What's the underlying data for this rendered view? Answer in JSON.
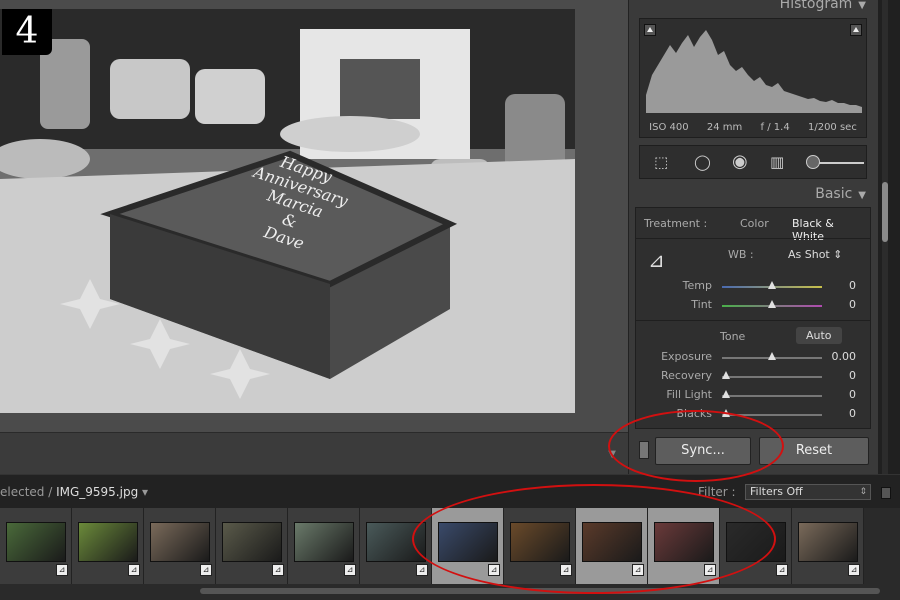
{
  "step_badge": "4",
  "photo": {
    "cake_text_lines": [
      "Happy",
      "Anniversary",
      "Marcia",
      "&",
      "Dave"
    ]
  },
  "right_panel": {
    "histogram": {
      "title": "Histogram",
      "exif": {
        "iso": "ISO 400",
        "focal_length": "24 mm",
        "aperture": "f / 1.4",
        "shutter": "1/200 sec"
      }
    },
    "tools": [
      "crop-overlay-icon",
      "spot-removal-icon",
      "red-eye-icon",
      "graduated-filter-icon",
      "adjustment-brush-icon"
    ],
    "basic": {
      "title": "Basic",
      "treatment_label": "Treatment :",
      "treatment_color": "Color",
      "treatment_bw": "Black & White",
      "wb_label": "WB :",
      "wb_value": "As Shot",
      "temp": {
        "label": "Temp",
        "value": "0",
        "position": 0.5
      },
      "tint": {
        "label": "Tint",
        "value": "0",
        "position": 0.5
      },
      "tone_label": "Tone",
      "auto_label": "Auto",
      "exposure": {
        "label": "Exposure",
        "value": "0.00",
        "position": 0.5
      },
      "recovery": {
        "label": "Recovery",
        "value": "0",
        "position": 0.0
      },
      "fill_light": {
        "label": "Fill Light",
        "value": "0",
        "position": 0.0
      },
      "blacks": {
        "label": "Blacks",
        "value": "0",
        "position": 0.0
      }
    },
    "sync_button": "Sync...",
    "reset_button": "Reset"
  },
  "filmstrip_bar": {
    "path_prefix": "elected / ",
    "filename": "IMG_9595.jpg",
    "filter_label": "Filter :",
    "filter_value": "Filters Off"
  },
  "filmstrip": {
    "thumbnails": [
      {
        "selected": false,
        "tone": "#4a6a3a"
      },
      {
        "selected": false,
        "tone": "#6b8a3a"
      },
      {
        "selected": false,
        "tone": "#7a6a5a"
      },
      {
        "selected": false,
        "tone": "#5a5a4a"
      },
      {
        "selected": false,
        "tone": "#6a7a6a"
      },
      {
        "selected": false,
        "tone": "#4a5a5a"
      },
      {
        "selected": true,
        "tone": "#3a4a6a"
      },
      {
        "selected": false,
        "tone": "#6a4a2a"
      },
      {
        "selected": true,
        "tone": "#5a3a2a"
      },
      {
        "selected": true,
        "tone": "#6a3a3a"
      },
      {
        "selected": false,
        "tone": "#2a2a2a"
      },
      {
        "selected": false,
        "tone": "#7a6a5a"
      }
    ]
  },
  "colors": {
    "annotation": "#d21010",
    "panel": "#3a3a3a",
    "app_bg": "#000000"
  }
}
